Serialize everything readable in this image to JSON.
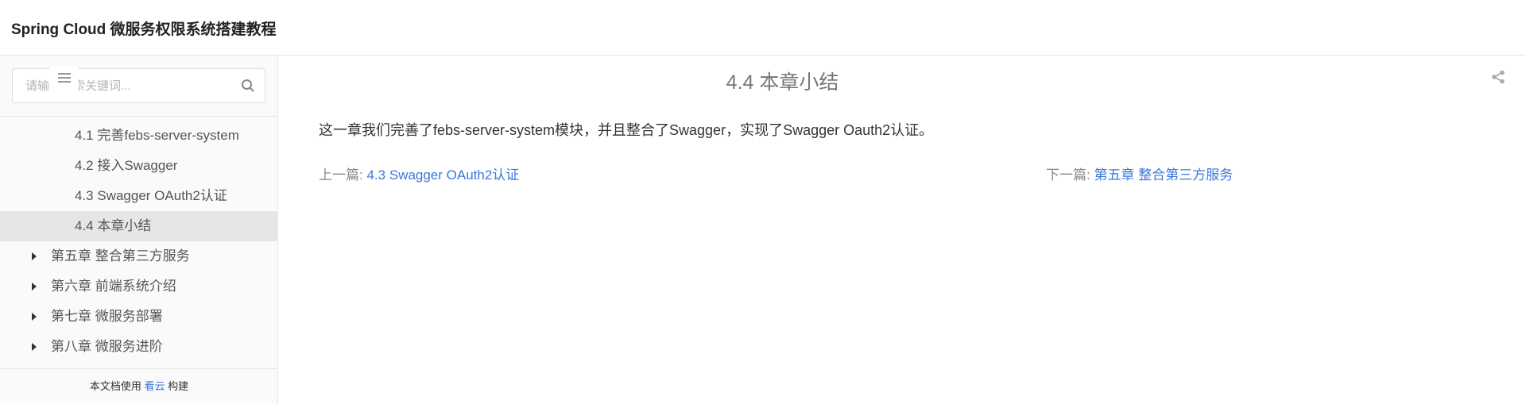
{
  "header": {
    "title": "Spring Cloud 微服务权限系统搭建教程"
  },
  "search": {
    "placeholder": "请输入搜索关键词..."
  },
  "toc": {
    "items": [
      {
        "label": "4.1 完善febs-server-system"
      },
      {
        "label": "4.2 接入Swagger"
      },
      {
        "label": "4.3 Swagger OAuth2认证"
      },
      {
        "label": "4.4 本章小结"
      },
      {
        "label": "第五章 整合第三方服务"
      },
      {
        "label": "第六章 前端系统介绍"
      },
      {
        "label": "第七章 微服务部署"
      },
      {
        "label": "第八章 微服务进阶"
      }
    ],
    "active_index": 3
  },
  "footer": {
    "prefix": "本文档使用",
    "link": "看云",
    "suffix": "构建"
  },
  "main": {
    "title": "4.4 本章小结",
    "paragraph": "这一章我们完善了febs-server-system模块，并且整合了Swagger，实现了Swagger Oauth2认证。",
    "prev_label": "上一篇:",
    "prev_link": "4.3 Swagger OAuth2认证",
    "next_label": "下一篇:",
    "next_link": "第五章 整合第三方服务"
  },
  "colors": {
    "link": "#3c78d8",
    "active_bg": "#e6e6e6"
  },
  "icons": {
    "search": "search-icon",
    "menu": "menu-icon",
    "share": "share-icon",
    "caret": "caret-right-icon"
  }
}
